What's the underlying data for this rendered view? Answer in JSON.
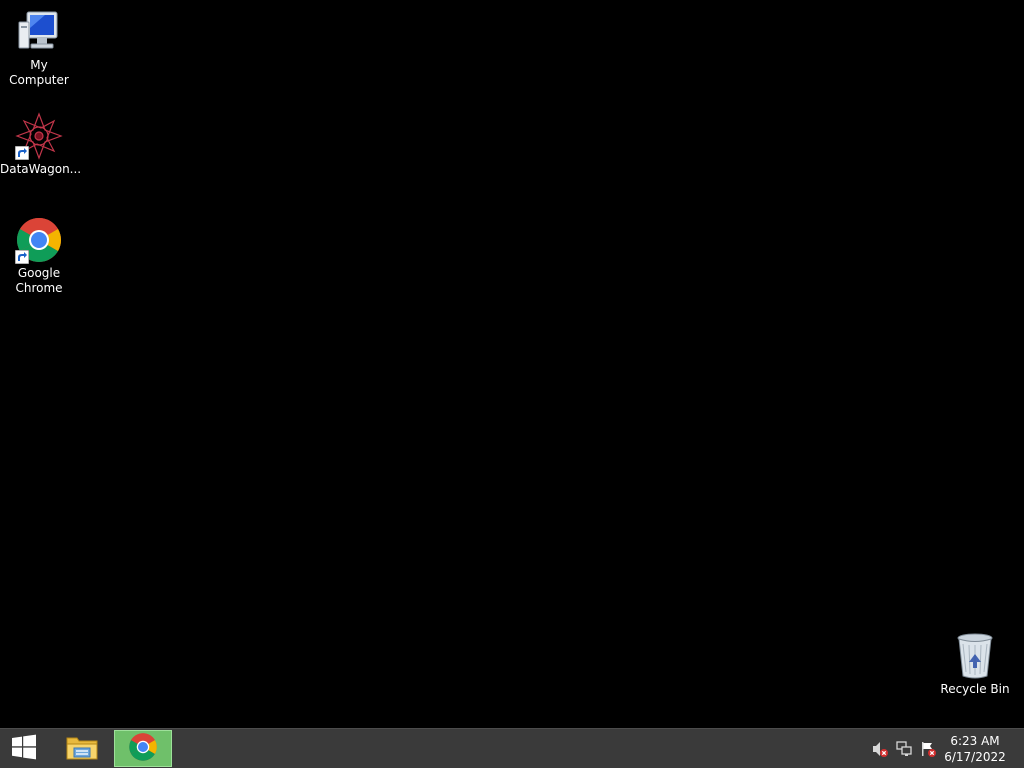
{
  "desktop": {
    "background_color": "#000000",
    "icons": [
      {
        "label": "My Computer",
        "icon": "my-computer-icon"
      },
      {
        "label": "DataWagon...",
        "icon": "datawagon-icon",
        "shortcut": true
      },
      {
        "label": "Google Chrome",
        "icon": "chrome-icon",
        "shortcut": true
      },
      {
        "label": "Recycle Bin",
        "icon": "recycle-bin-icon"
      }
    ]
  },
  "taskbar": {
    "background_color": "#3a3a3a",
    "start_icon": "windows-logo-icon",
    "pinned": [
      {
        "icon": "file-explorer-icon",
        "active": false
      },
      {
        "icon": "chrome-icon",
        "active": true,
        "active_color": "#6fc06a"
      }
    ],
    "tray": [
      {
        "icon": "speaker-muted-icon"
      },
      {
        "icon": "network-icon"
      },
      {
        "icon": "action-center-flag-icon"
      }
    ],
    "clock": {
      "time": "6:23 AM",
      "date": "6/17/2022"
    }
  }
}
